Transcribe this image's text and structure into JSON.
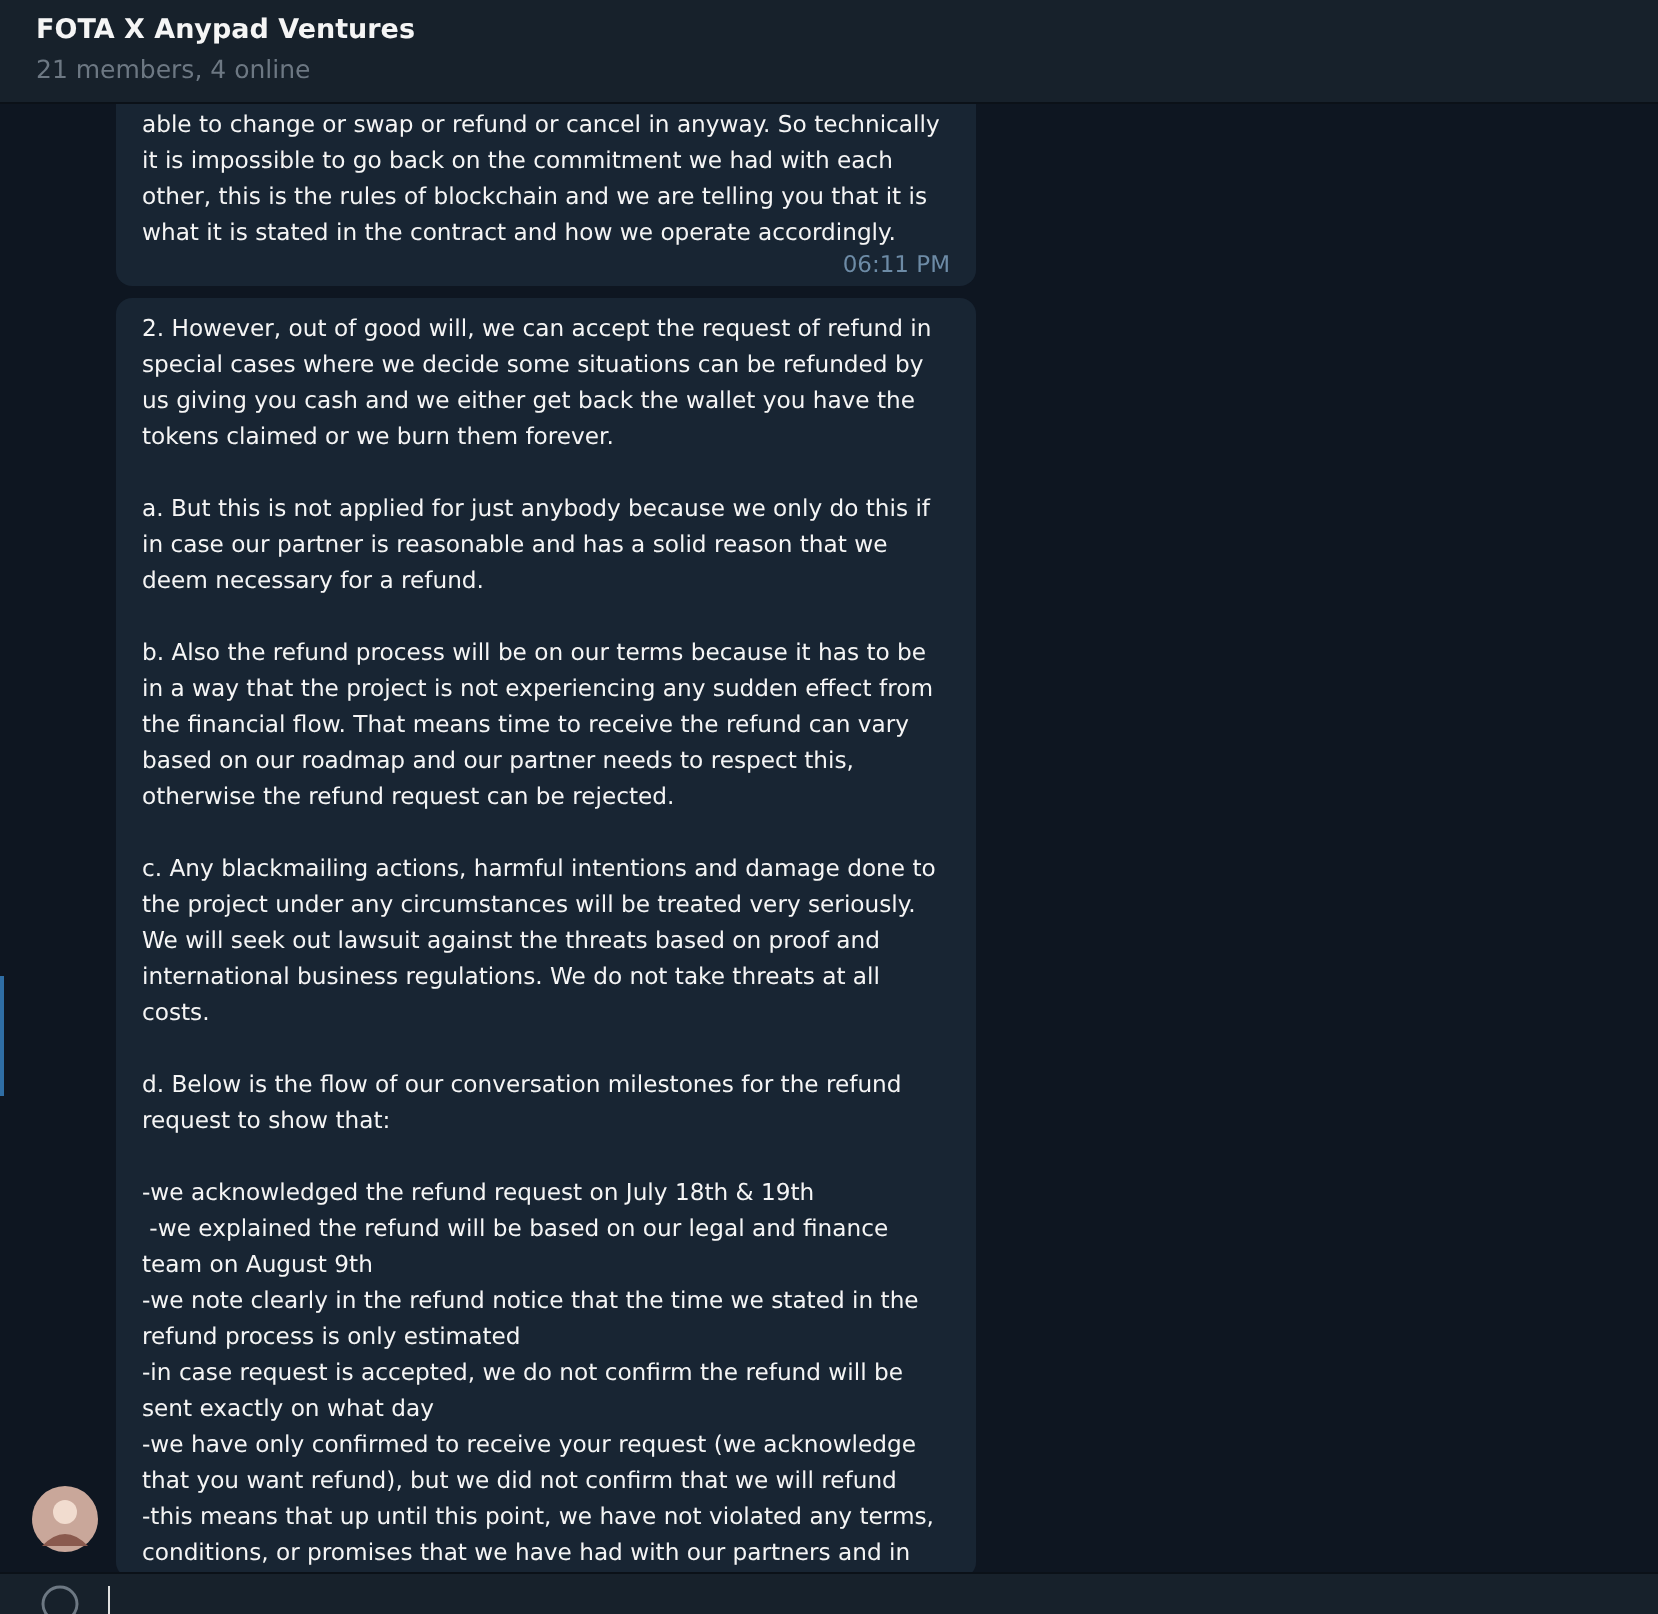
{
  "header": {
    "title": "FOTA X Anypad Ventures",
    "subtitle": "21 members, 4 online"
  },
  "messages": [
    {
      "paragraphs": [
        [
          "able to change or swap or refund or cancel in anyway. So technically",
          "it is impossible to go back on the commitment we had with each",
          "other, this is the rules of blockchain and we are telling you that it is",
          "what it is stated in the contract and how we operate accordingly."
        ]
      ],
      "time": "06:11 PM"
    },
    {
      "paragraphs": [
        [
          "2. However, out of good will, we can accept the request of refund in",
          "special cases where we decide some situations can be refunded by",
          "us giving you cash and we either get back the wallet you have the",
          "tokens claimed or we burn them forever."
        ],
        [
          "a. But this is not applied for just anybody because we only do this if",
          "in case our partner is reasonable and has a solid reason that we",
          "deem necessary for a refund."
        ],
        [
          "b. Also the refund process will be on our terms because it has to be",
          "in a way that the project is not experiencing any sudden effect from",
          "the financial flow. That means time to receive the refund can vary",
          "based on our roadmap and our partner needs to respect this,",
          "otherwise the refund request can be rejected."
        ],
        [
          "c. Any blackmailing actions, harmful intentions and damage done to",
          "the project under any circumstances will be treated very seriously.",
          "We will seek out lawsuit against the threats based on proof and",
          "international business regulations. We do not take threats at all",
          "costs."
        ],
        [
          "d. Below is the flow of our conversation milestones for the refund",
          "request to show that:"
        ],
        [
          "-we acknowledged the refund request on July 18th & 19th",
          " -we explained the refund will be based on our legal and finance",
          "team on August 9th",
          "-we note clearly in the refund notice that the time we stated in the",
          "refund process is only estimated",
          "-in case request is accepted, we do not confirm the refund will be",
          "sent exactly on what day",
          "-we have only confirmed to receive your request (we acknowledge",
          "that you want refund), but we did not confirm that we will refund",
          "-this means that up until this point, we have not violated any terms,",
          "conditions, or promises that we have had with our partners and in"
        ]
      ]
    }
  ]
}
